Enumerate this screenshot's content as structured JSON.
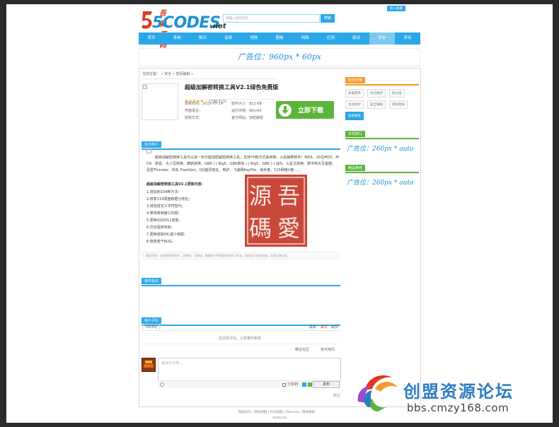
{
  "header": {
    "logo_sub": "吾爱源码",
    "logo_main": "5CODES",
    "logo_net": ".net",
    "search_placeholder": "请输入搜索内容",
    "search_button": "搜索",
    "favorite_button": "加入收藏"
  },
  "nav": [
    "首页",
    "系统",
    "聊天",
    "音频",
    "视频",
    "图像",
    "网络",
    "应用",
    "驱动",
    "安全",
    "资讯"
  ],
  "nav_active_index": 9,
  "ads": {
    "top": "广告位：960px * 60px",
    "side1": "广告位：260px * auto",
    "side2": "广告位：260px * auto"
  },
  "breadcrumb": "当前位置： » 安全 » 密码破解 »",
  "software": {
    "title": "超级加解密转换工具V2.1绿色免费版",
    "stars": "★★★★★",
    "rating_note": "(下载:572)",
    "update_label": "更新时间：2015-07-14",
    "size_label": "软件大小：812 KB",
    "interface_label": "界面语言：",
    "platform_label": "运行环境：Win/All",
    "license_label": "授权方式：",
    "website_label": "官方网站：加密解密",
    "download_button": "立即下载"
  },
  "intro": {
    "section_title": "软件简介",
    "paragraph": "超级加解密转换工具可以进一步万能加密解密转换工具，支持75种方式来转换，火星解释软件！MD5、16位MD5、MD4、拼音、大小写转换、摩斯转换、GBK (-) Big5、GBK简体 (-) Big5、GBK (-) SJIS、火星文转换、数字到大写金额、迅雷Thunder、快车 FlashGet、QQ旋风地址、电驴、飞速网RayFile、纳米盘、115网络U盘……",
    "update_title": "超级加解密转换工具V2.1更新内容：",
    "items": [
      "1.增加到104种方法;",
      "2.修复115网盘数据分地址;",
      "3.增加自定义字符替代;",
      "4.菜单移到窗口内部;",
      "5.更换QQ2011皮肤;",
      "6.优化程序体积;",
      "7.更换皮肤08,减少误报;",
      "8.修复若干BUG。"
    ],
    "disclaimer": "版权声明：本站提供的软件、注册码、注册机、破解补丁等资源仅供学习交流，请勿用于商业用途，否则后果自负。"
  },
  "tech_section_title": "猜你喜欢",
  "comments": {
    "section_title": "用户评论",
    "count_tab": "0条评论",
    "sort_latest": "最新",
    "sort_hot": "最早",
    "sort_top": "最热",
    "empty_text": "还没有评论，沙发等你来抢",
    "login_text": "畅言社区",
    "share_text": "有可用问",
    "textarea_placeholder": "说点什么吧...",
    "share_label": "分享到：",
    "post_button": "发布",
    "footer_brand": "畅言"
  },
  "sidebar": {
    "tags_title": "软件分类",
    "tags": [
      "杀毒软件",
      "木马防护",
      "防火墙",
      "主动防护",
      "安全辅助",
      "密码相关",
      "加密解密"
    ],
    "rank_title": "本周排行",
    "new_title": "精品推荐"
  },
  "footer": {
    "links": "网站首页 | 网站地图 | RSS地图 | Sitemap | 网站模板",
    "powered": "dedecms"
  },
  "seal": {
    "chars": [
      "吾",
      "源",
      "愛",
      "碼"
    ]
  },
  "watermark": {
    "title": "创盟资源论坛",
    "url": "bbs.cmzy168.com"
  },
  "colors": {
    "accent": "#2aa7e8",
    "sidebar_tags": "#f39c2a",
    "sidebar_rank": "#5bb53b",
    "download": "#5bb53b",
    "seal": "#c43425",
    "watermark_blue": "#2d7cc2"
  }
}
